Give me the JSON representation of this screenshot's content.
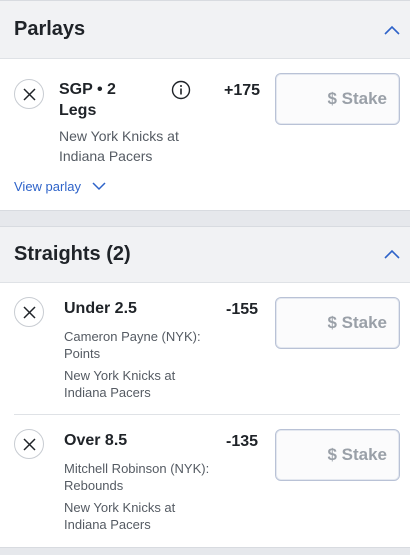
{
  "parlays": {
    "title": "Parlays",
    "bet": {
      "title_line1": "SGP • 2",
      "title_line2": "Legs",
      "odds": "+175",
      "event_line1": "New York Knicks at",
      "event_line2": "Indiana Pacers",
      "stake_placeholder": "$ Stake"
    },
    "view_parlay_label": "View parlay"
  },
  "straights": {
    "title": "Straights (2)",
    "bets": [
      {
        "title": "Under 2.5",
        "odds": "-155",
        "player_line1": "Cameron Payne (NYK):",
        "player_line2": "Points",
        "event_line1": "New York Knicks at",
        "event_line2": "Indiana Pacers",
        "stake_placeholder": "$ Stake"
      },
      {
        "title": "Over 8.5",
        "odds": "-135",
        "player_line1": "Mitchell Robinson (NYK):",
        "player_line2": "Rebounds",
        "event_line1": "New York Knicks at",
        "event_line2": "Indiana Pacers",
        "stake_placeholder": "$ Stake"
      }
    ]
  },
  "icons": {
    "remove": "close-icon",
    "info": "info-icon",
    "collapse": "chevron-up-icon",
    "expand": "chevron-down-icon"
  },
  "colors": {
    "link": "#2e63c9",
    "section_header_bg": "#f1f2f4",
    "stake_border": "#b9c2d6"
  }
}
